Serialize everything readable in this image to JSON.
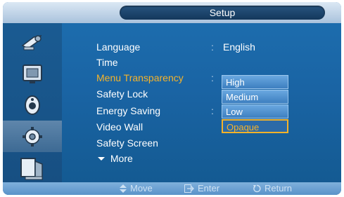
{
  "title": "Setup",
  "sidebar": {
    "items": [
      {
        "icon": "picture-icon"
      },
      {
        "icon": "screen-icon"
      },
      {
        "icon": "sound-icon"
      },
      {
        "icon": "setup-gear-icon"
      },
      {
        "icon": "multi-window-icon"
      }
    ],
    "active_index": 3
  },
  "menu": {
    "items": [
      {
        "label": "Language",
        "value": "English"
      },
      {
        "label": "Time",
        "value": ""
      },
      {
        "label": "Menu Transparency",
        "value": ""
      },
      {
        "label": "Safety Lock",
        "value": ""
      },
      {
        "label": "Energy Saving",
        "value": ""
      },
      {
        "label": "Video Wall",
        "value": ""
      },
      {
        "label": "Safety Screen",
        "value": ""
      },
      {
        "label": "More",
        "value": ""
      }
    ],
    "selected_index": 2
  },
  "dropdown": {
    "options": [
      "High",
      "Medium",
      "Low",
      "Opaque"
    ],
    "selected": "Opaque"
  },
  "footer": {
    "move": "Move",
    "enter": "Enter",
    "return": "Return"
  },
  "colors": {
    "accent": "#f5b32a",
    "background": "#1a64a4"
  }
}
